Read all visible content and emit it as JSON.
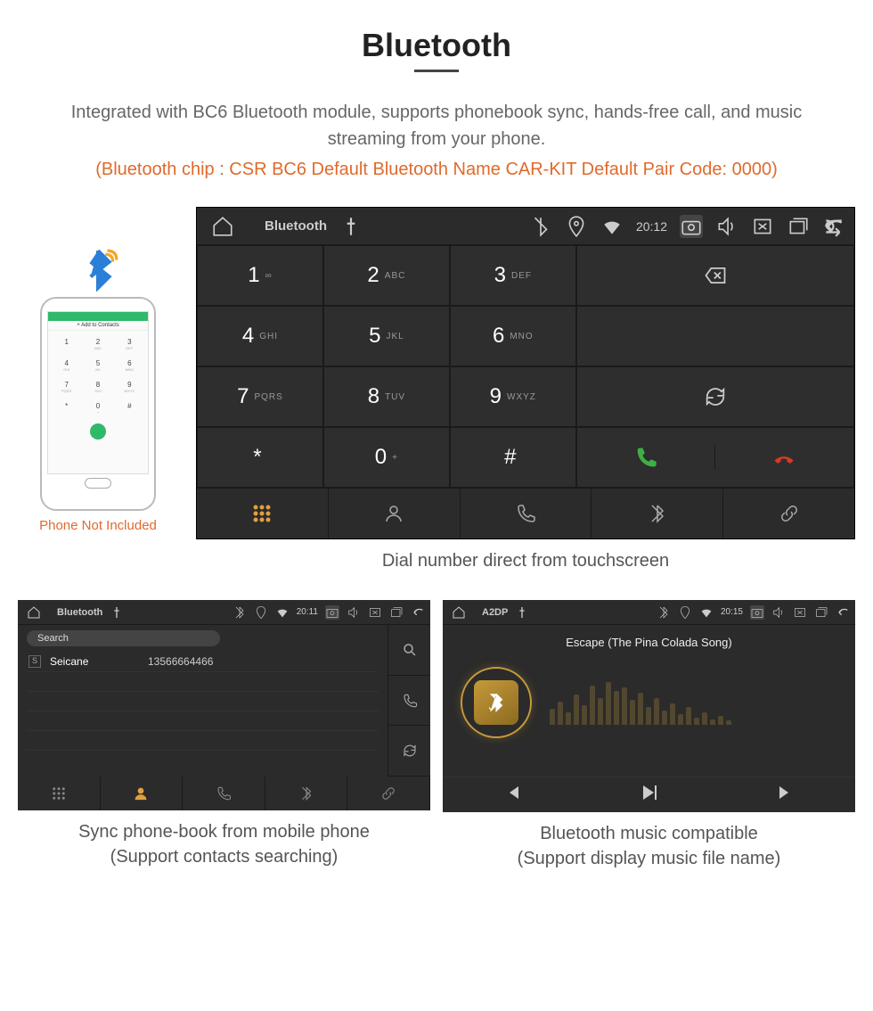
{
  "heading": "Bluetooth",
  "description": "Integrated with BC6 Bluetooth module, supports phonebook sync, hands-free call, and music streaming from your phone.",
  "spec_line": "(Bluetooth chip : CSR BC6     Default Bluetooth Name CAR-KIT     Default Pair Code: 0000)",
  "phone": {
    "add_contacts": "+  Add to Contacts",
    "keys": [
      "1",
      "2",
      "3",
      "4",
      "5",
      "6",
      "7",
      "8",
      "9",
      "*",
      "0",
      "#"
    ],
    "subs": [
      "",
      "ABC",
      "DEF",
      "GHI",
      "JKL",
      "MNO",
      "PQRS",
      "TUV",
      "WXYZ",
      "",
      "+",
      ""
    ],
    "note": "Phone Not Included"
  },
  "dialer": {
    "status_title": "Bluetooth",
    "time": "20:12",
    "keypad": [
      {
        "num": "1",
        "sub": "∞"
      },
      {
        "num": "2",
        "sub": "ABC"
      },
      {
        "num": "3",
        "sub": "DEF"
      },
      {
        "num": "4",
        "sub": "GHI"
      },
      {
        "num": "5",
        "sub": "JKL"
      },
      {
        "num": "6",
        "sub": "MNO"
      },
      {
        "num": "7",
        "sub": "PQRS"
      },
      {
        "num": "8",
        "sub": "TUV"
      },
      {
        "num": "9",
        "sub": "WXYZ"
      },
      {
        "num": "*",
        "sub": ""
      },
      {
        "num": "0",
        "sub": "+"
      },
      {
        "num": "#",
        "sub": ""
      }
    ],
    "caption": "Dial number direct from touchscreen"
  },
  "contacts": {
    "status_title": "Bluetooth",
    "time": "20:11",
    "search_placeholder": "Search",
    "entry_initial": "S",
    "entry_name": "Seicane",
    "entry_number": "13566664466",
    "caption_line1": "Sync phone-book from mobile phone",
    "caption_line2": "(Support contacts searching)"
  },
  "music": {
    "status_title": "A2DP",
    "time": "20:15",
    "track": "Escape (The Pina Colada Song)",
    "caption_line1": "Bluetooth music compatible",
    "caption_line2": "(Support display music file name)"
  }
}
